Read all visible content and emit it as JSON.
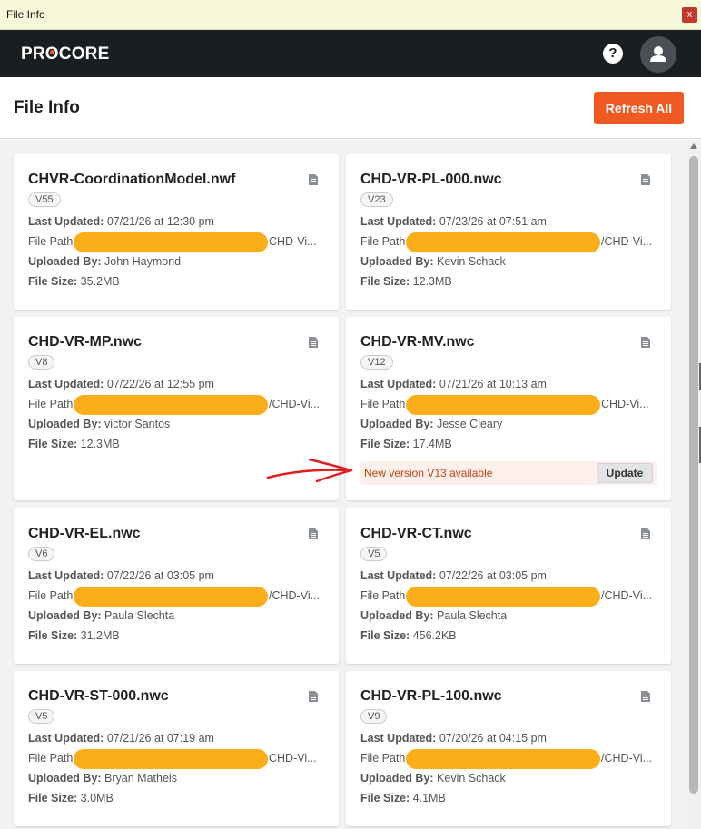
{
  "window": {
    "title": "File Info",
    "close_label": "x"
  },
  "header": {
    "logo": "PROCORE",
    "help_icon": "question-icon",
    "avatar_icon": "user-icon"
  },
  "page": {
    "title": "File Info",
    "refresh_label": "Refresh All"
  },
  "labels": {
    "last_updated": "Last Updated:",
    "file_path": "File Path",
    "uploaded_by": "Uploaded By:",
    "file_size": "File Size:"
  },
  "files": [
    {
      "name": "CHVR-CoordinationModel.nwf",
      "version": "V55",
      "last_updated": "07/21/26 at 12:30 pm",
      "path_tail": "CHD-Vi...",
      "uploaded_by": "John Haymond",
      "size": "35.2MB"
    },
    {
      "name": "CHD-VR-PL-000.nwc",
      "version": "V23",
      "last_updated": "07/23/26 at 07:51 am",
      "path_tail": "/CHD-Vi...",
      "uploaded_by": "Kevin Schack",
      "size": "12.3MB"
    },
    {
      "name": "CHD-VR-MP.nwc",
      "version": "V8",
      "last_updated": "07/22/26 at 12:55 pm",
      "path_tail": "/CHD-Vi...",
      "uploaded_by": "victor Santos",
      "size": "12.3MB"
    },
    {
      "name": "CHD-VR-MV.nwc",
      "version": "V12",
      "last_updated": "07/21/26 at 10:13 am",
      "path_tail": "CHD-Vi...",
      "uploaded_by": "Jesse Cleary",
      "size": "17.4MB",
      "update_message": "New version V13 available",
      "update_label": "Update"
    },
    {
      "name": "CHD-VR-EL.nwc",
      "version": "V6",
      "last_updated": "07/22/26 at 03:05 pm",
      "path_tail": "/CHD-Vi...",
      "uploaded_by": "Paula Slechta",
      "size": "31.2MB"
    },
    {
      "name": "CHD-VR-CT.nwc",
      "version": "V5",
      "last_updated": "07/22/26 at 03:05 pm",
      "path_tail": "/CHD-Vi...",
      "uploaded_by": "Paula Slechta",
      "size": "456.2KB"
    },
    {
      "name": "CHD-VR-ST-000.nwc",
      "version": "V5",
      "last_updated": "07/21/26 at 07:19 am",
      "path_tail": "CHD-Vi...",
      "uploaded_by": "Bryan Matheis",
      "size": "3.0MB"
    },
    {
      "name": "CHD-VR-PL-100.nwc",
      "version": "V9",
      "last_updated": "07/20/26 at 04:15 pm",
      "path_tail": "/CHD-Vi...",
      "uploaded_by": "Kevin Schack",
      "size": "4.1MB"
    }
  ],
  "colors": {
    "accent": "#f05a22",
    "redaction": "#fcae1a",
    "annotation": "#e02020",
    "header_bg": "#1b1e21"
  }
}
